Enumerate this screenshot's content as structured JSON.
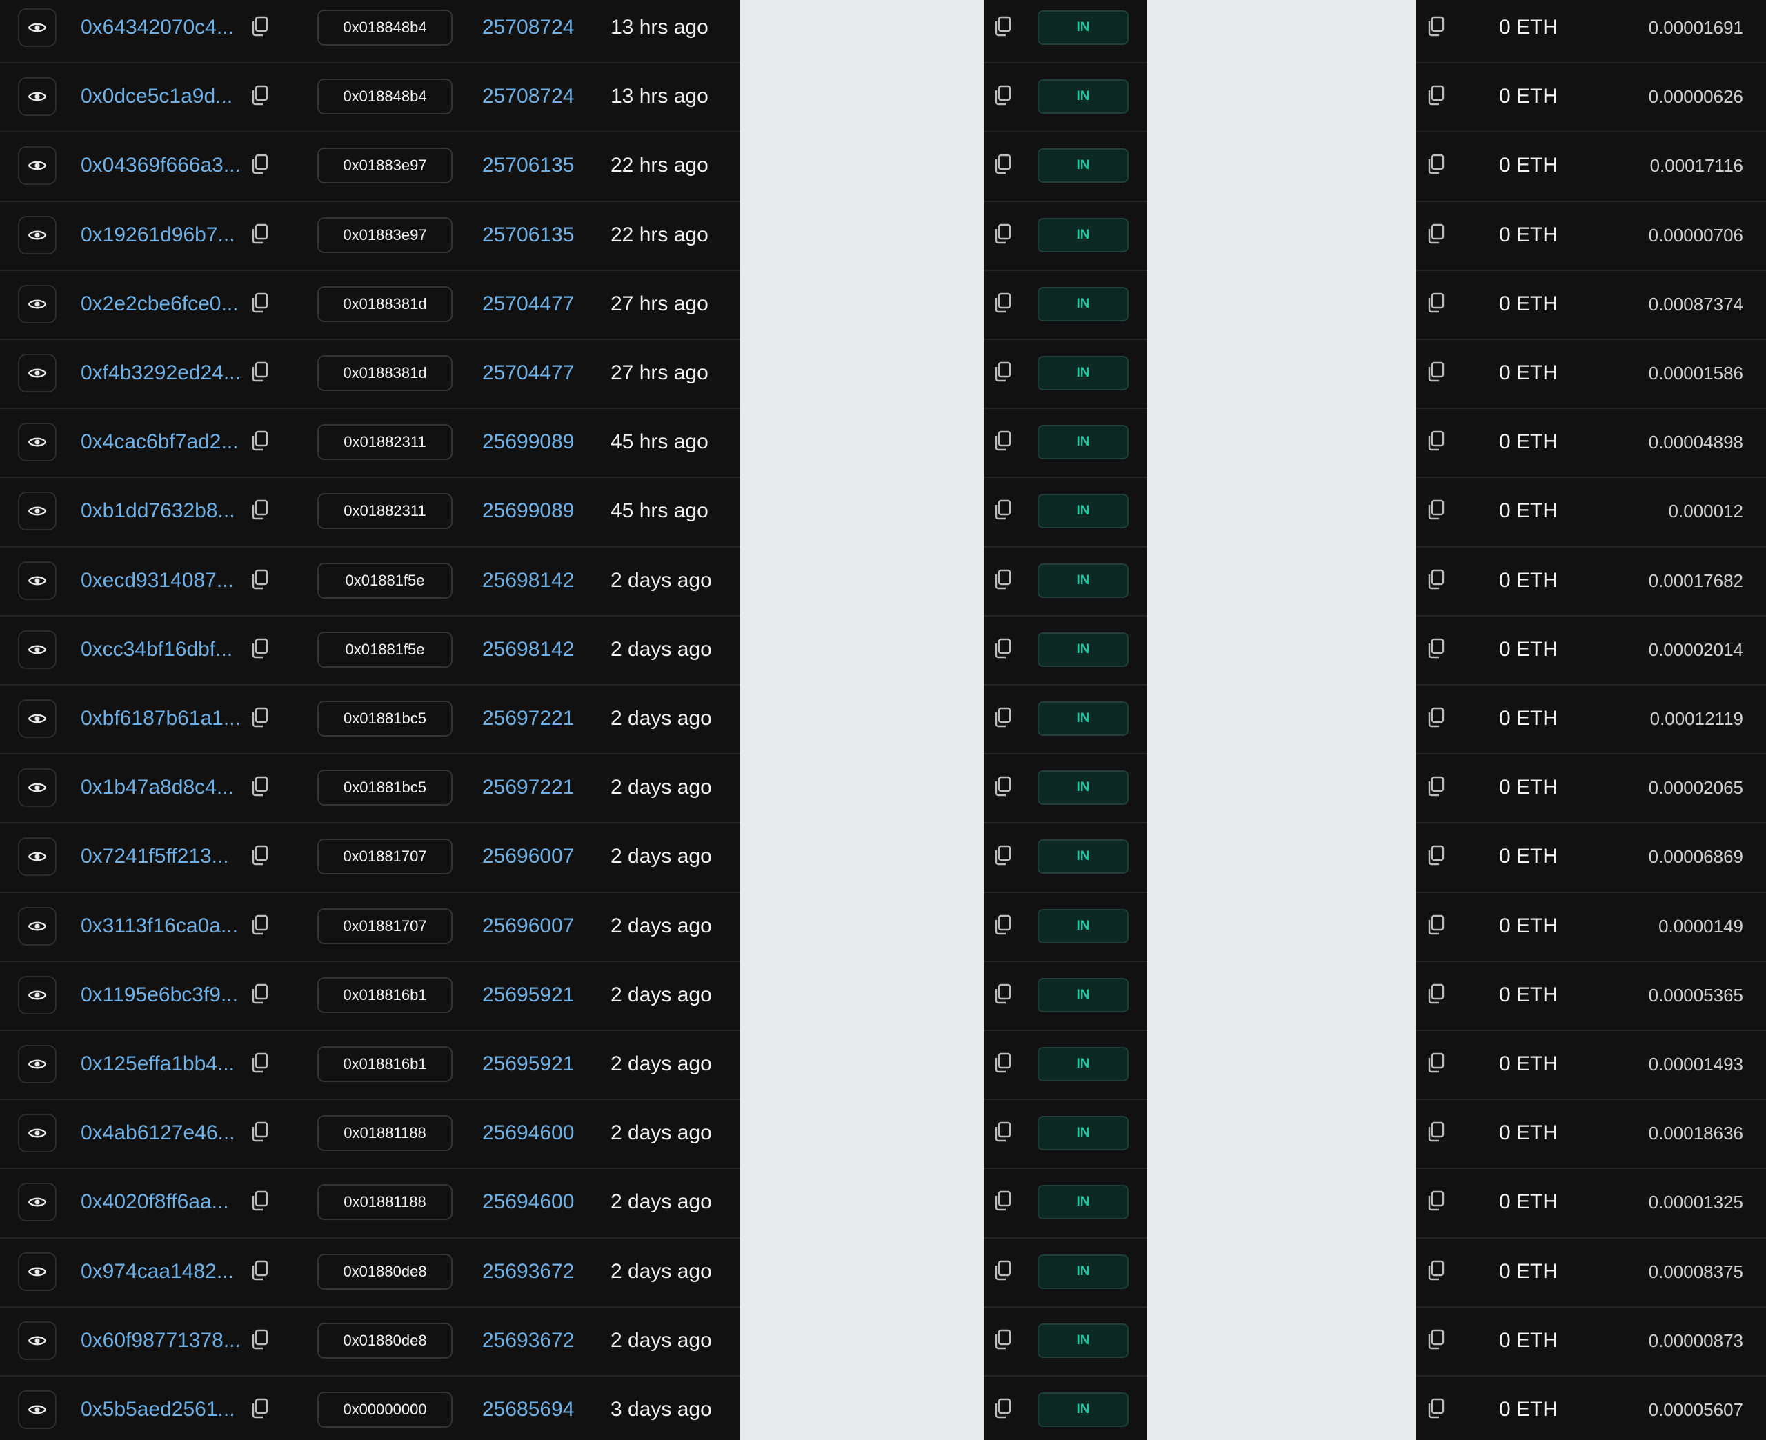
{
  "colors": {
    "panel_bg": "#111111",
    "page_bg": "#e8ebed",
    "link": "#6fb1e6",
    "text": "#f2f2f2",
    "in_badge_bg": "#0b2823",
    "in_badge_text": "#1fc7a2"
  },
  "icons": {
    "view": "eye-icon",
    "copy": "copy-icon"
  },
  "rows": [
    {
      "hash": "0x64342070c4...",
      "method": "0x018848b4",
      "block": "25708724",
      "age": "13 hrs ago",
      "direction": "IN",
      "value": "0 ETH",
      "fee": "0.00001691"
    },
    {
      "hash": "0x0dce5c1a9d...",
      "method": "0x018848b4",
      "block": "25708724",
      "age": "13 hrs ago",
      "direction": "IN",
      "value": "0 ETH",
      "fee": "0.00000626"
    },
    {
      "hash": "0x04369f666a3...",
      "method": "0x01883e97",
      "block": "25706135",
      "age": "22 hrs ago",
      "direction": "IN",
      "value": "0 ETH",
      "fee": "0.00017116"
    },
    {
      "hash": "0x19261d96b7...",
      "method": "0x01883e97",
      "block": "25706135",
      "age": "22 hrs ago",
      "direction": "IN",
      "value": "0 ETH",
      "fee": "0.00000706"
    },
    {
      "hash": "0x2e2cbe6fce0...",
      "method": "0x0188381d",
      "block": "25704477",
      "age": "27 hrs ago",
      "direction": "IN",
      "value": "0 ETH",
      "fee": "0.00087374"
    },
    {
      "hash": "0xf4b3292ed24...",
      "method": "0x0188381d",
      "block": "25704477",
      "age": "27 hrs ago",
      "direction": "IN",
      "value": "0 ETH",
      "fee": "0.00001586"
    },
    {
      "hash": "0x4cac6bf7ad2...",
      "method": "0x01882311",
      "block": "25699089",
      "age": "45 hrs ago",
      "direction": "IN",
      "value": "0 ETH",
      "fee": "0.00004898"
    },
    {
      "hash": "0xb1dd7632b8...",
      "method": "0x01882311",
      "block": "25699089",
      "age": "45 hrs ago",
      "direction": "IN",
      "value": "0 ETH",
      "fee": "0.000012"
    },
    {
      "hash": "0xecd9314087...",
      "method": "0x01881f5e",
      "block": "25698142",
      "age": "2 days ago",
      "direction": "IN",
      "value": "0 ETH",
      "fee": "0.00017682"
    },
    {
      "hash": "0xcc34bf16dbf...",
      "method": "0x01881f5e",
      "block": "25698142",
      "age": "2 days ago",
      "direction": "IN",
      "value": "0 ETH",
      "fee": "0.00002014"
    },
    {
      "hash": "0xbf6187b61a1...",
      "method": "0x01881bc5",
      "block": "25697221",
      "age": "2 days ago",
      "direction": "IN",
      "value": "0 ETH",
      "fee": "0.00012119"
    },
    {
      "hash": "0x1b47a8d8c4...",
      "method": "0x01881bc5",
      "block": "25697221",
      "age": "2 days ago",
      "direction": "IN",
      "value": "0 ETH",
      "fee": "0.00002065"
    },
    {
      "hash": "0x7241f5ff213...",
      "method": "0x01881707",
      "block": "25696007",
      "age": "2 days ago",
      "direction": "IN",
      "value": "0 ETH",
      "fee": "0.00006869"
    },
    {
      "hash": "0x3113f16ca0a...",
      "method": "0x01881707",
      "block": "25696007",
      "age": "2 days ago",
      "direction": "IN",
      "value": "0 ETH",
      "fee": "0.0000149"
    },
    {
      "hash": "0x1195e6bc3f9...",
      "method": "0x018816b1",
      "block": "25695921",
      "age": "2 days ago",
      "direction": "IN",
      "value": "0 ETH",
      "fee": "0.00005365"
    },
    {
      "hash": "0x125effa1bb4...",
      "method": "0x018816b1",
      "block": "25695921",
      "age": "2 days ago",
      "direction": "IN",
      "value": "0 ETH",
      "fee": "0.00001493"
    },
    {
      "hash": "0x4ab6127e46...",
      "method": "0x01881188",
      "block": "25694600",
      "age": "2 days ago",
      "direction": "IN",
      "value": "0 ETH",
      "fee": "0.00018636"
    },
    {
      "hash": "0x4020f8ff6aa...",
      "method": "0x01881188",
      "block": "25694600",
      "age": "2 days ago",
      "direction": "IN",
      "value": "0 ETH",
      "fee": "0.00001325"
    },
    {
      "hash": "0x974caa1482...",
      "method": "0x01880de8",
      "block": "25693672",
      "age": "2 days ago",
      "direction": "IN",
      "value": "0 ETH",
      "fee": "0.00008375"
    },
    {
      "hash": "0x60f98771378...",
      "method": "0x01880de8",
      "block": "25693672",
      "age": "2 days ago",
      "direction": "IN",
      "value": "0 ETH",
      "fee": "0.00000873"
    },
    {
      "hash": "0x5b5aed2561...",
      "method": "0x00000000",
      "block": "25685694",
      "age": "3 days ago",
      "direction": "IN",
      "value": "0 ETH",
      "fee": "0.00005607"
    }
  ]
}
